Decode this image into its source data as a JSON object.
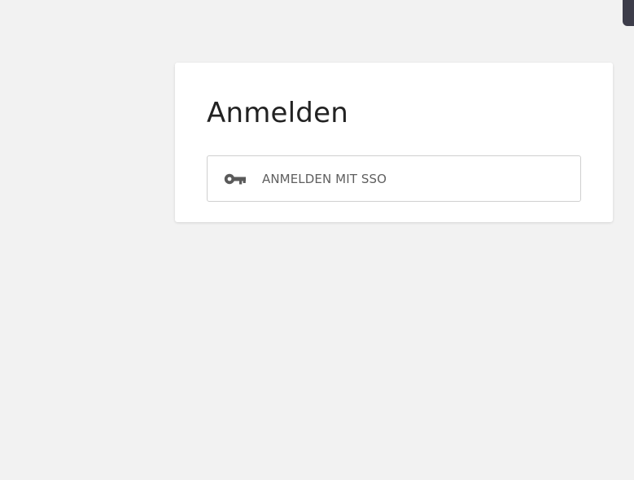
{
  "login": {
    "title": "Anmelden",
    "sso_button": {
      "label": "ANMELDEN MIT SSO",
      "icon": "key-icon"
    }
  },
  "colors": {
    "background": "#f2f2f2",
    "card": "#ffffff",
    "title_text": "#222222",
    "button_text": "#5f5f5f",
    "icon": "#5a5a5a",
    "corner_tab": "#3d3d4a"
  }
}
